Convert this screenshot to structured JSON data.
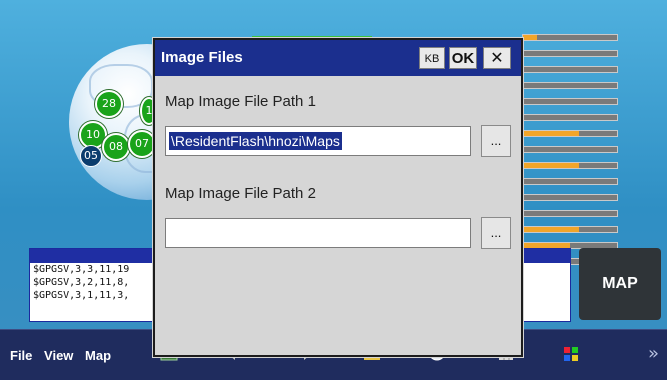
{
  "dialog": {
    "title": "Image Files",
    "kb_label": "KB",
    "ok_label": "OK",
    "close_label": "✕",
    "path1_label": "Map Image File Path 1",
    "path1_value": "\\ResidentFlash\\hnozi\\Maps",
    "browse1_label": "...",
    "path2_label": "Map Image File Path 2",
    "path2_value": "",
    "browse2_label": "..."
  },
  "satellites": [
    {
      "id": "28"
    },
    {
      "id": "1"
    },
    {
      "id": "10"
    },
    {
      "id": "08"
    },
    {
      "id": "07"
    },
    {
      "id": "05"
    }
  ],
  "nmea_lines": [
    "$GPGSV,3,3,11,19",
    "$GPGSV,3,2,11,8,",
    "$GPGSV,3,1,11,3,"
  ],
  "map_button": "MAP",
  "menu": {
    "file": "File",
    "view": "View",
    "map": "Map"
  },
  "taskbar_chevron": "»",
  "signal_levels": [
    0.15,
    0.0,
    0.0,
    0.0,
    0.0,
    0.0,
    0.6,
    0.0,
    0.6,
    0.0,
    0.0,
    0.0,
    0.6,
    0.5,
    0.0
  ],
  "colors": {
    "titlebar": "#1b2f8e",
    "signal_bar": "#f1a52a",
    "satellite": "#1aa31a"
  }
}
